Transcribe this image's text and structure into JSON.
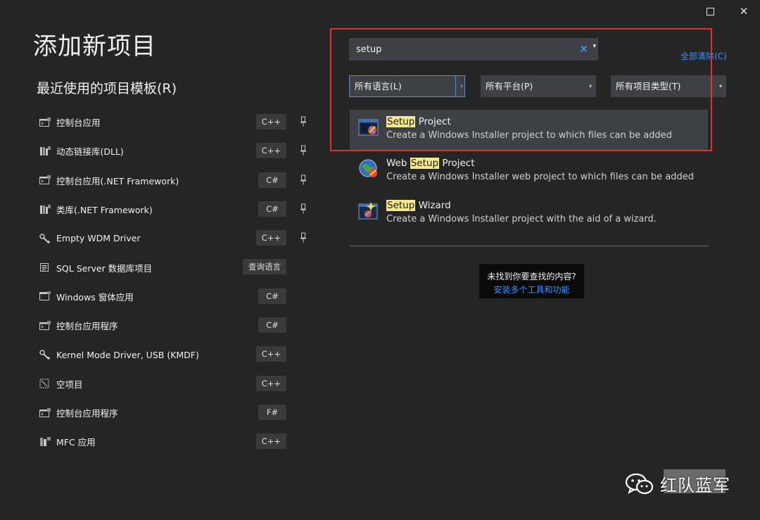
{
  "window": {
    "maximize_icon": "maximize-icon",
    "close_icon": "close-icon",
    "close_glyph": "✕"
  },
  "page_title": "添加新项目",
  "recent": {
    "title": "最近使用的项目模板(R)",
    "items": [
      {
        "label": "控制台应用",
        "tag": "C++",
        "icon": "console-app-icon",
        "pinned": true
      },
      {
        "label": "动态链接库(DLL)",
        "tag": "C++",
        "icon": "dll-icon",
        "pinned": true
      },
      {
        "label": "控制台应用(.NET Framework)",
        "tag": "C#",
        "icon": "console-app-icon",
        "pinned": true
      },
      {
        "label": "类库(.NET Framework)",
        "tag": "C#",
        "icon": "class-library-icon",
        "pinned": true
      },
      {
        "label": "Empty WDM Driver",
        "tag": "C++",
        "icon": "driver-icon",
        "pinned": true
      },
      {
        "label": "SQL Server 数据库项目",
        "tag": "查询语言",
        "icon": "database-project-icon",
        "pinned": false
      },
      {
        "label": "Windows 窗体应用",
        "tag": "C#",
        "icon": "windows-form-icon",
        "pinned": false
      },
      {
        "label": "控制台应用程序",
        "tag": "C#",
        "icon": "console-app-icon",
        "pinned": false
      },
      {
        "label": "Kernel Mode Driver, USB (KMDF)",
        "tag": "C++",
        "icon": "driver-icon",
        "pinned": false
      },
      {
        "label": "空项目",
        "tag": "C++",
        "icon": "empty-project-icon",
        "pinned": false
      },
      {
        "label": "控制台应用程序",
        "tag": "F#",
        "icon": "console-app-icon",
        "pinned": false
      },
      {
        "label": "MFC 应用",
        "tag": "C++",
        "icon": "mfc-app-icon",
        "pinned": false
      }
    ]
  },
  "search": {
    "value": "setup",
    "clear_icon": "clear-icon",
    "clear_glyph": "×",
    "dropdown_icon": "dropdown-caret-icon",
    "dropdown_glyph": "▾"
  },
  "clear_all": "全部清除(C)",
  "filters": {
    "language": "所有语言(L)",
    "platform": "所有平台(P)",
    "project_type": "所有项目类型(T)",
    "caret_glyph": "▾"
  },
  "results": [
    {
      "title_before": "",
      "highlight": "Setup",
      "title_after": " Project",
      "desc": "Create a Windows Installer project to which files can be added",
      "icon": "setup-project-icon",
      "selected": true
    },
    {
      "title_before": "Web ",
      "highlight": "Setup",
      "title_after": " Project",
      "desc": "Create a Windows Installer web project to which files can be added",
      "icon": "web-setup-project-icon",
      "selected": false
    },
    {
      "title_before": "",
      "highlight": "Setup",
      "title_after": " Wizard",
      "desc": "Create a Windows Installer project with the aid of a wizard.",
      "icon": "setup-wizard-icon",
      "selected": false
    }
  ],
  "not_found": {
    "question": "未找到你要查找的内容?",
    "link": "安装多个工具和功能"
  },
  "watermark": {
    "text": "红队蓝军",
    "icon": "wechat-icon"
  },
  "colors": {
    "background": "#252526",
    "panel": "#3f3f46",
    "accent": "#3794ff",
    "highlight": "#f5e98c",
    "annotation": "#e0322e"
  }
}
